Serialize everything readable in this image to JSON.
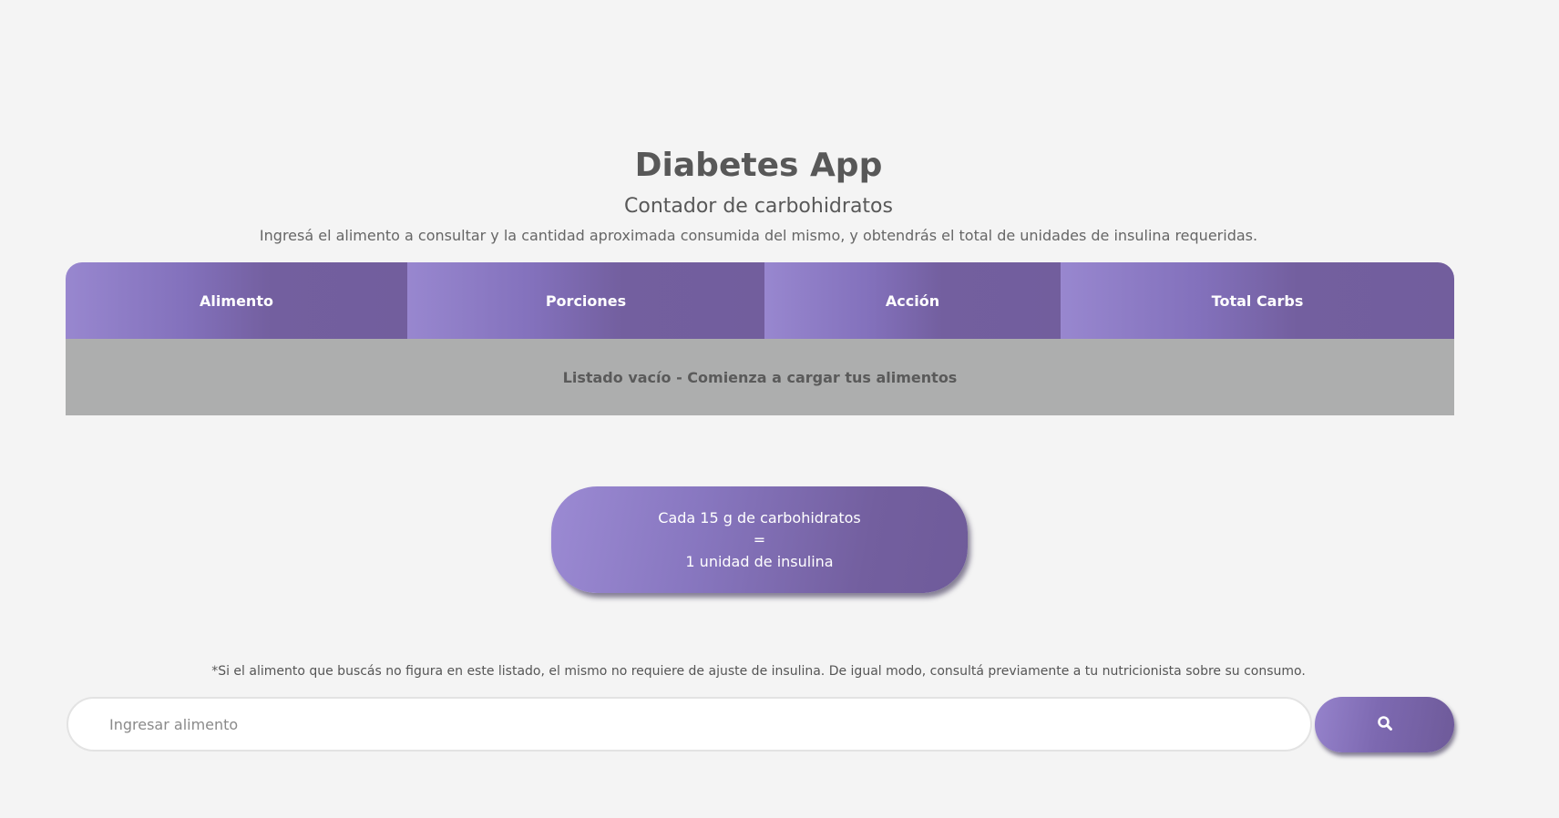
{
  "header": {
    "title": "Diabetes App",
    "subtitle": "Contador de carbohidratos",
    "description": "Ingresá el alimento a consultar y la cantidad aproximada consumida del mismo, y obtendrás el total de unidades de insulina requeridas."
  },
  "table": {
    "columns": [
      "Alimento",
      "Porciones",
      "Acción",
      "Total Carbs"
    ],
    "empty_message": "Listado vacío - Comienza a cargar tus alimentos"
  },
  "info_card": {
    "line1": "Cada 15 g de carbohidratos",
    "line2": "=",
    "line3": "1 unidad de insulina"
  },
  "note": "*Si el alimento que buscás no figura en este listado, el mismo no requiere de ajuste de insulina. De igual modo, consultá previamente a tu nutricionista sobre su consumo.",
  "search": {
    "placeholder": "Ingresar alimento",
    "value": "",
    "button_icon": "search-icon"
  },
  "colors": {
    "background": "#f4f4f4",
    "accent_light": "#9887cf",
    "accent_dark": "#725e9d",
    "empty_row": "#adaeae",
    "text": "#585858"
  }
}
